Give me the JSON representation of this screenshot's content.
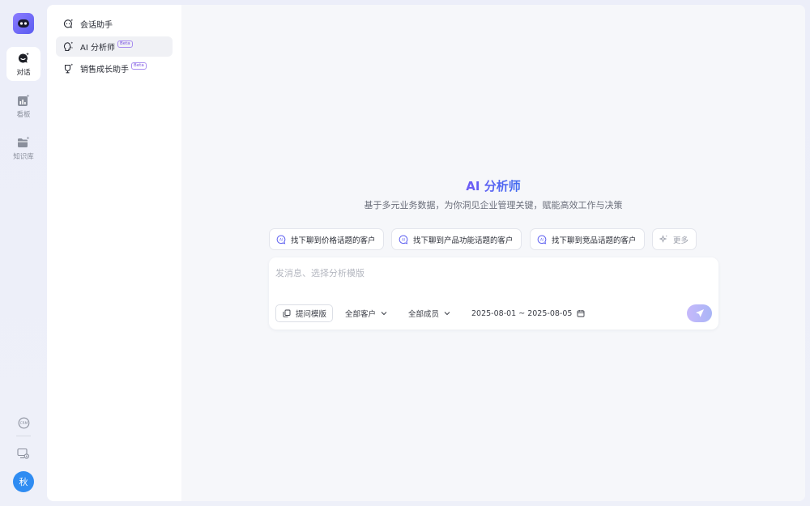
{
  "rail": {
    "items": [
      {
        "label": "对话"
      },
      {
        "label": "看板"
      },
      {
        "label": "知识库"
      }
    ],
    "crm_label": "CRM",
    "avatar_text": "秋"
  },
  "subnav": {
    "items": [
      {
        "label": "会话助手",
        "badge": ""
      },
      {
        "label": "AI 分析师",
        "badge": "Beta"
      },
      {
        "label": "销售成长助手",
        "badge": "Beta"
      }
    ]
  },
  "hero": {
    "title": "AI 分析师",
    "subtitle": "基于多元业务数据，为你洞见企业管理关键，赋能高效工作与决策"
  },
  "suggestions": [
    {
      "label": "找下聊到价格话题的客户"
    },
    {
      "label": "找下聊到产品功能话题的客户"
    },
    {
      "label": "找下聊到竞品话题的客户"
    }
  ],
  "more_label": "更多",
  "composer": {
    "placeholder": "发消息、选择分析模版",
    "template_label": "提问模版",
    "customer_filter": "全部客户",
    "member_filter": "全部成员",
    "date_range": "2025-08-01 ~ 2025-08-05"
  },
  "colors": {
    "accent": "#5a5cf0",
    "avatar": "#2f8cf2",
    "beta": "#7b55e0"
  }
}
